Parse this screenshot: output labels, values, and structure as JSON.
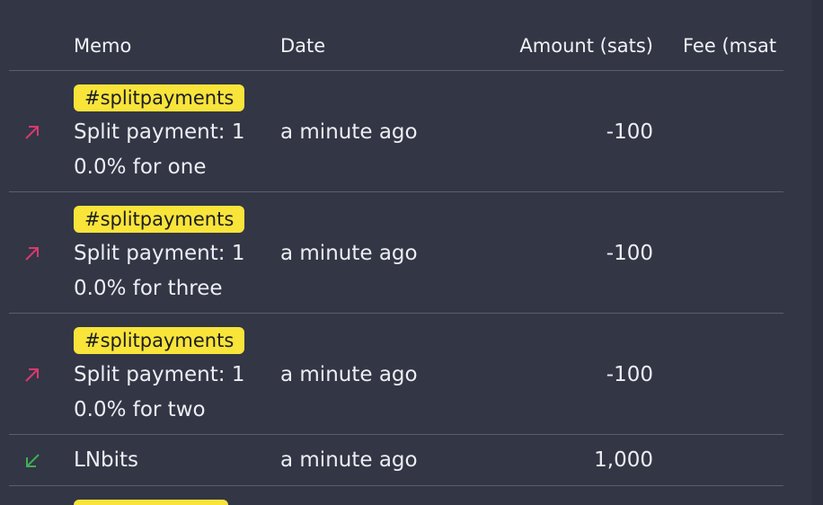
{
  "table": {
    "columns": {
      "memo": "Memo",
      "date": "Date",
      "amount": "Amount (sats)",
      "fee": "Fee (msat"
    },
    "rows": [
      {
        "direction": "outgoing",
        "direction_icon": "arrow-up-right-icon",
        "tag": "#splitpayments",
        "memo_line1": "Split payment: 1",
        "memo_line2": "0.0% for one",
        "date": "a minute ago",
        "amount": "-100"
      },
      {
        "direction": "outgoing",
        "direction_icon": "arrow-up-right-icon",
        "tag": "#splitpayments",
        "memo_line1": "Split payment: 1",
        "memo_line2": "0.0% for three",
        "date": "a minute ago",
        "amount": "-100"
      },
      {
        "direction": "outgoing",
        "direction_icon": "arrow-up-right-icon",
        "tag": "#splitpayments",
        "memo_line1": "Split payment: 1",
        "memo_line2": "0.0% for two",
        "date": "a minute ago",
        "amount": "-100"
      },
      {
        "direction": "incoming",
        "direction_icon": "arrow-down-left-icon",
        "memo": "LNbits",
        "date": "a minute ago",
        "amount": "1,000"
      }
    ]
  },
  "colors": {
    "background": "#333645",
    "tag_bg": "#f9e43a",
    "outgoing": "#d63a6e",
    "incoming": "#3fae57"
  }
}
